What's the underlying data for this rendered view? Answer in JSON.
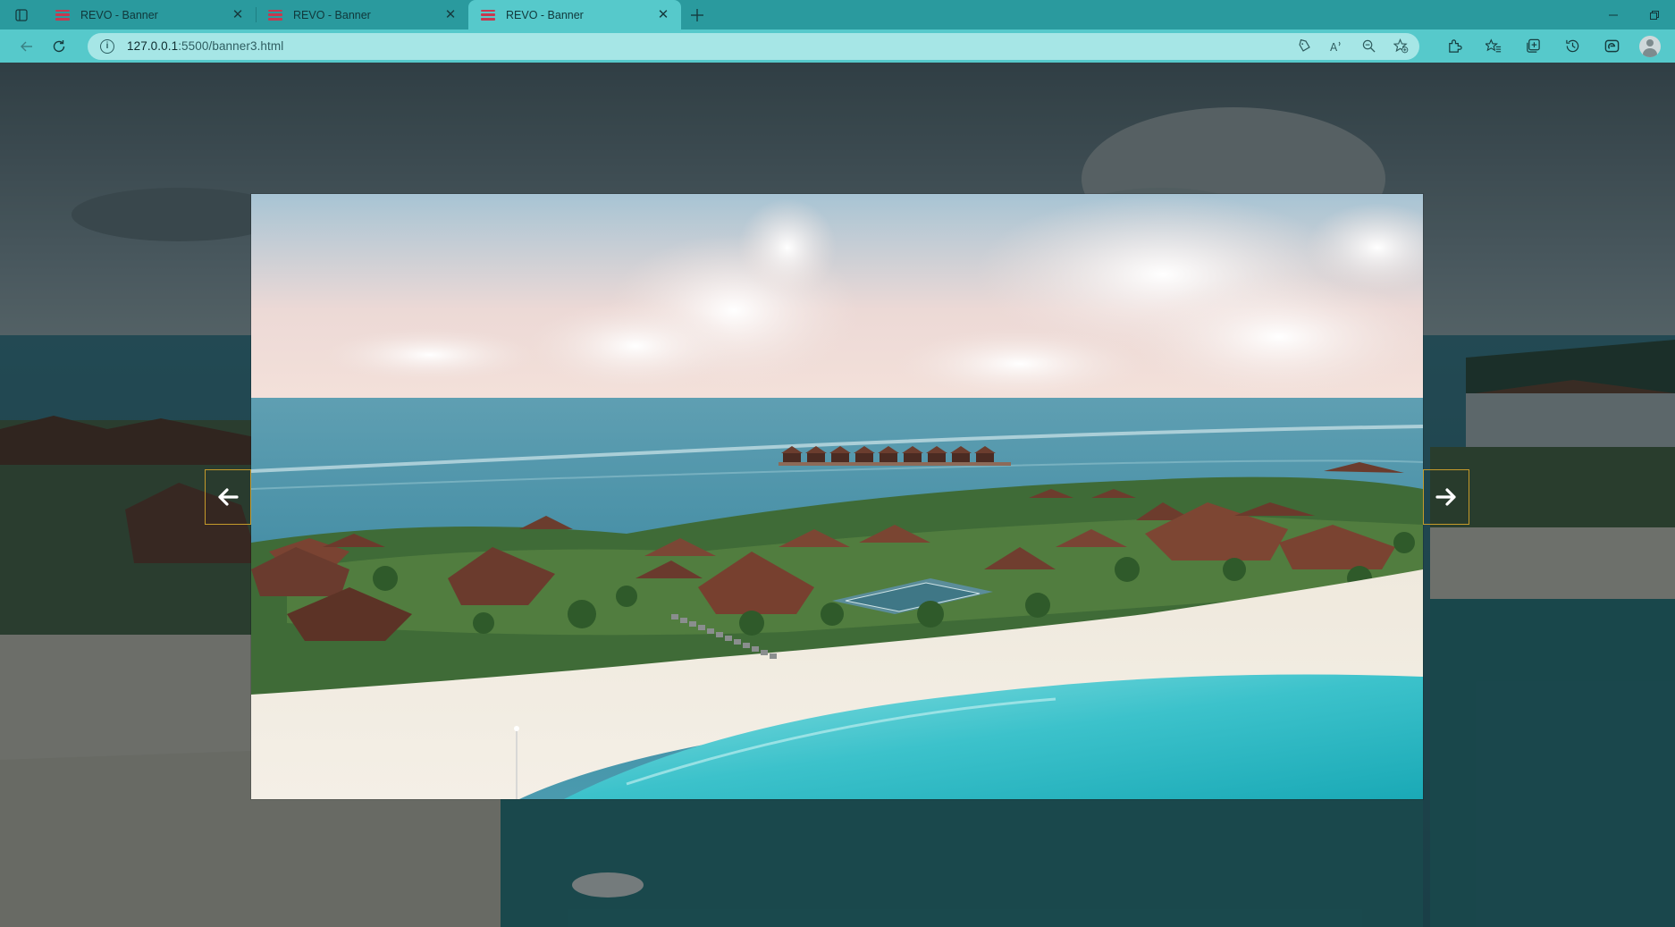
{
  "browser": {
    "tabs": [
      {
        "title": "REVO - Banner",
        "active": false
      },
      {
        "title": "REVO - Banner",
        "active": false
      },
      {
        "title": "REVO - Banner",
        "active": true
      }
    ],
    "address": {
      "host": "127.0.0.1",
      "path": ":5500/banner3.html"
    }
  },
  "icons": {
    "tab_actions": "tab-actions-icon",
    "favicon": "revo-hamburger-icon",
    "close": "close-icon",
    "new_tab": "plus-icon",
    "back": "back-arrow-icon",
    "reload": "reload-icon",
    "site_info": "info-icon",
    "omnibox": [
      "tag-icon",
      "read-aloud-icon",
      "zoom-out-icon",
      "favorite-add-icon"
    ],
    "toolbar": [
      "extensions-icon",
      "favorites-icon",
      "collections-icon",
      "history-icon",
      "edge-copilot-icon"
    ],
    "profile": "profile-avatar-icon",
    "slider_prev": "arrow-left-icon",
    "slider_next": "arrow-right-icon"
  },
  "colors": {
    "tabbar": "#2a9a9e",
    "toolbar": "#56c9cb",
    "omnibox": "#a6e6e6",
    "arrow_border": "#c59a2b",
    "favicon": "#c8384e"
  },
  "banner": {
    "image_description_icon": "tropical-resort-aerial-image"
  }
}
